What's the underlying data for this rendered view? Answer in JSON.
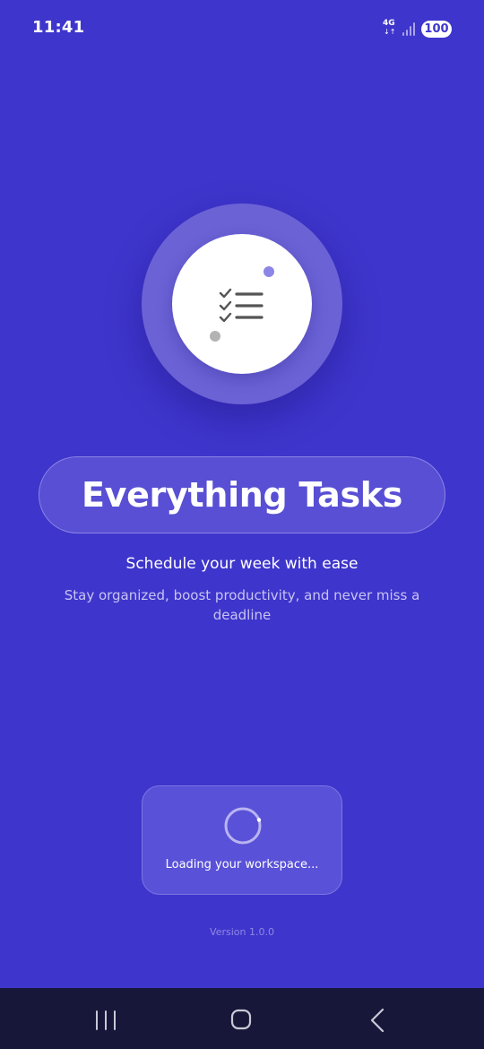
{
  "status_bar": {
    "time": "11:41",
    "network_label": "4G",
    "network_arrows": "↓↑",
    "battery": "100"
  },
  "splash": {
    "logo_icon": "checklist-icon",
    "title": "Everything Tasks",
    "tagline": "Schedule your week with ease",
    "description": "Stay organized, boost productivity, and never miss a deadline"
  },
  "loading": {
    "text": "Loading your workspace...",
    "icon": "spinner-icon"
  },
  "version": "Version 1.0.0",
  "nav_bar": {
    "recents_icon": "recents-icon",
    "home_icon": "home-icon",
    "back_icon": "back-icon"
  },
  "colors": {
    "background": "#3e35cc",
    "accent_dot": "#8c86e6",
    "nav_bar": "#17173a"
  }
}
